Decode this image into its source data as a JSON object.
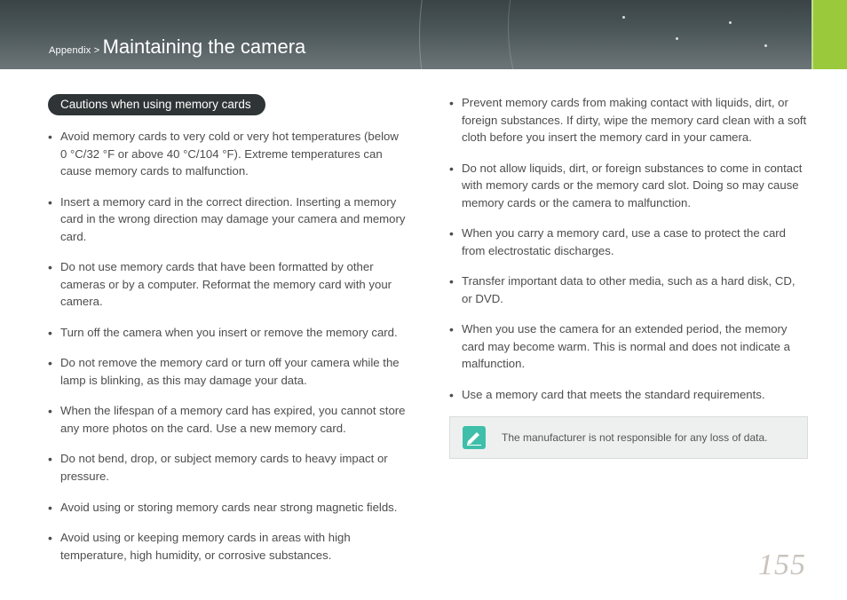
{
  "header": {
    "breadcrumb_prefix": "Appendix > ",
    "title": "Maintaining the camera"
  },
  "section": {
    "heading": "Cautions when using memory cards"
  },
  "left_bullets": [
    "Avoid memory cards to very cold or very hot temperatures (below 0 °C/32 °F or above 40 °C/104 °F). Extreme temperatures can cause memory cards to malfunction.",
    "Insert a memory card in the correct direction. Inserting a memory card in the wrong direction may damage your camera and memory card.",
    "Do not use memory cards that have been formatted by other cameras or by a computer. Reformat the memory card with your camera.",
    "Turn off the camera when you insert or remove the memory card.",
    "Do not remove the memory card or turn off your camera while the lamp is blinking, as this may damage your data.",
    "When the lifespan of a memory card has expired, you cannot store any more photos on the card. Use a new memory card.",
    "Do not bend, drop, or subject memory cards to heavy impact or pressure.",
    "Avoid using or storing memory cards near strong magnetic fields.",
    "Avoid using or keeping memory cards in areas with high temperature, high humidity, or corrosive substances."
  ],
  "right_bullets": [
    "Prevent memory cards from making contact with liquids, dirt, or foreign substances. If dirty, wipe the memory card clean with a soft cloth before you insert the memory card in your camera.",
    "Do not allow liquids, dirt, or foreign substances to come in contact with memory cards or the memory card slot. Doing so may cause memory cards or the camera to malfunction.",
    "When you carry a memory card, use a case to protect the card from electrostatic discharges.",
    "Transfer important data to other media, such as a hard disk, CD, or DVD.",
    "When you use the camera for an extended period, the memory card may become warm. This is normal and does not indicate a malfunction.",
    "Use a memory card that meets the standard requirements."
  ],
  "note": {
    "text": "The manufacturer is not responsible for any loss of data."
  },
  "page_number": "155"
}
